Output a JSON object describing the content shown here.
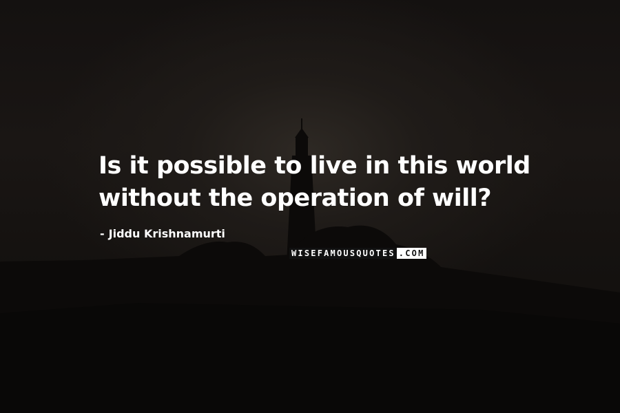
{
  "quote": {
    "line1": "Is it possible to live in this world",
    "line2": "without the operation of will?"
  },
  "author": {
    "dash": "-",
    "name": "Jiddu Krishnamurti"
  },
  "brand": {
    "dark_part": "WISEFAMOUSQUOTES",
    "light_part": ".COM"
  },
  "colors": {
    "text": "#ffffff",
    "background": "#141110",
    "silhouette": "#0c0a09"
  }
}
